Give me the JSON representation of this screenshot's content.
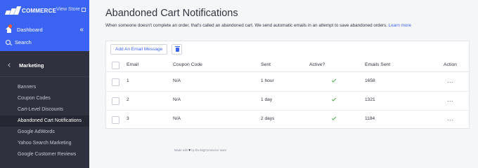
{
  "sidebar": {
    "brand": "COMMERCE",
    "view_store": "View Store",
    "dashboard": "Dashboard",
    "dashboard_collapse": "«",
    "search": "Search",
    "section": "Marketing",
    "items": [
      {
        "label": "Banners"
      },
      {
        "label": "Coupon Codes"
      },
      {
        "label": "Cart-Level Discounts"
      },
      {
        "label": "Abandoned Cart Notifications"
      },
      {
        "label": "Google AdWords"
      },
      {
        "label": "Yahoo Search Marketing"
      },
      {
        "label": "Google Customer Reviews"
      }
    ],
    "active_index": 3
  },
  "main": {
    "title": "Abandoned Cart Notifications",
    "description": "When someone doesn't complete an order, that's called an abandoned cart. We send automatic emails in an attempt to save abandoned orders.",
    "learn_more": "Learn more",
    "add_button": "Add An Email Message",
    "columns": {
      "email": "Email",
      "coupon": "Coupon Code",
      "sent": "Sent",
      "active": "Active?",
      "emails_sent": "Emails Sent",
      "action": "Action"
    },
    "rows": [
      {
        "email": "1",
        "coupon": "N/A",
        "sent": "1 hour",
        "active": true,
        "emails_sent": "1658",
        "action": "..."
      },
      {
        "email": "2",
        "coupon": "N/A",
        "sent": "1 day",
        "active": true,
        "emails_sent": "1321",
        "action": "..."
      },
      {
        "email": "3",
        "coupon": "N/A",
        "sent": "2 days",
        "active": true,
        "emails_sent": "1184",
        "action": "..."
      }
    ],
    "footer_prefix": "Made with",
    "footer_suffix": "by the BigCommerce team"
  },
  "colors": {
    "accent": "#3c64f4",
    "sidebar_bg": "#2f323e",
    "active_check": "#3dab3d"
  }
}
